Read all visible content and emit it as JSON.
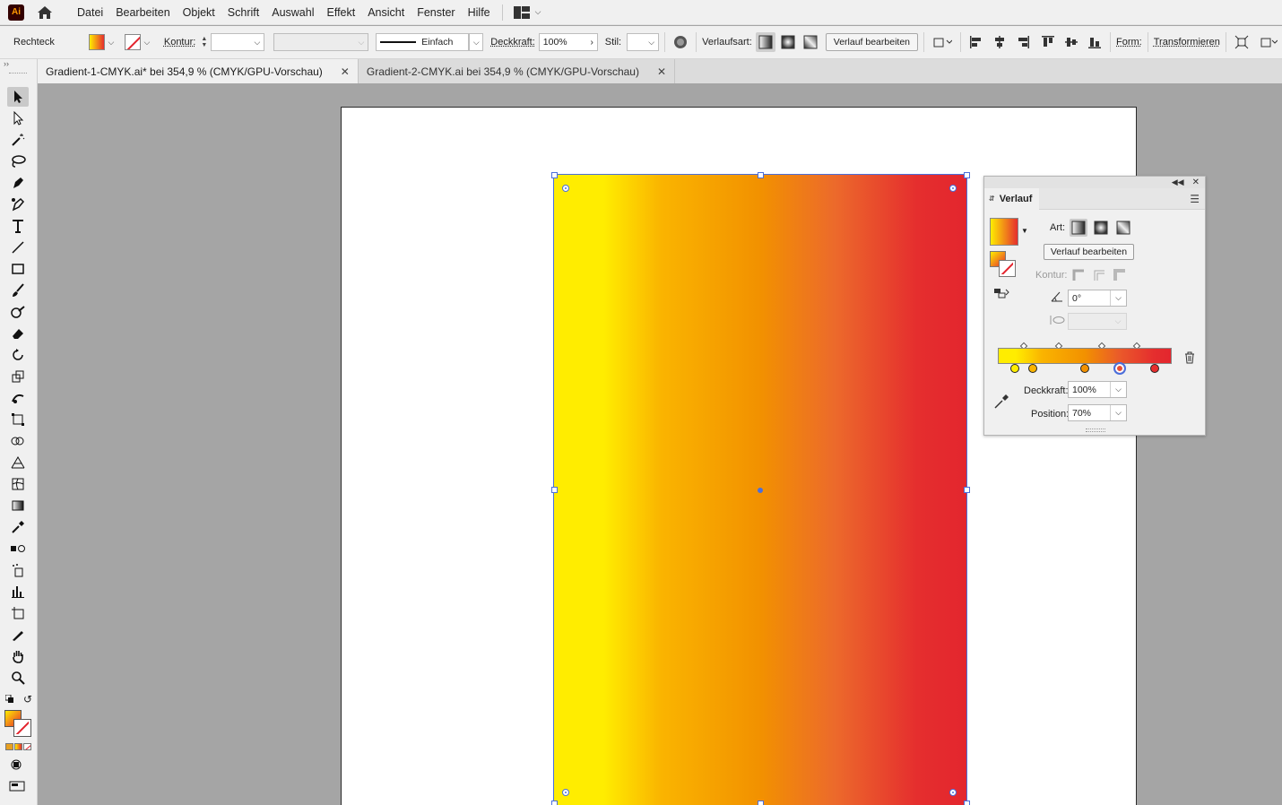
{
  "app": {
    "logo": "Ai"
  },
  "menu": [
    "Datei",
    "Bearbeiten",
    "Objekt",
    "Schrift",
    "Auswahl",
    "Effekt",
    "Ansicht",
    "Fenster",
    "Hilfe"
  ],
  "control": {
    "object_type": "Rechteck",
    "stroke_label": "Kontur:",
    "stroke_style": "Einfach",
    "opacity_label": "Deckkraft:",
    "opacity_value": "100%",
    "style_label": "Stil:",
    "gradient_type_label": "Verlaufsart:",
    "edit_gradient": "Verlauf bearbeiten",
    "shape_label": "Form:",
    "transform_label": "Transformieren"
  },
  "tabs": [
    {
      "label": "Gradient-1-CMYK.ai* bei 354,9 % (CMYK/GPU-Vorschau)",
      "active": true
    },
    {
      "label": "Gradient-2-CMYK.ai bei 354,9 % (CMYK/GPU-Vorschau)",
      "active": false
    }
  ],
  "gradient_panel": {
    "title": "Verlauf",
    "type_label": "Art:",
    "edit_button": "Verlauf bearbeiten",
    "stroke_label": "Kontur:",
    "angle_value": "0°",
    "opacity_label": "Deckkraft:",
    "opacity_value": "100%",
    "position_label": "Position:",
    "position_value": "70%",
    "stops": [
      {
        "color": "#ffed00",
        "position": 0.1
      },
      {
        "color": "#fab400",
        "position": 0.2
      },
      {
        "color": "#f29100",
        "position": 0.5
      },
      {
        "color": "#e94e35",
        "position": 0.7,
        "selected": true
      },
      {
        "color": "#e52e2e",
        "position": 0.9
      }
    ],
    "midpoints": [
      0.15,
      0.35,
      0.6,
      0.8
    ]
  },
  "colors": {
    "gradient_start": "#ffed00",
    "gradient_end": "#e3262e",
    "selection": "#4a6fdc",
    "stroke_none": "#e3232c"
  }
}
